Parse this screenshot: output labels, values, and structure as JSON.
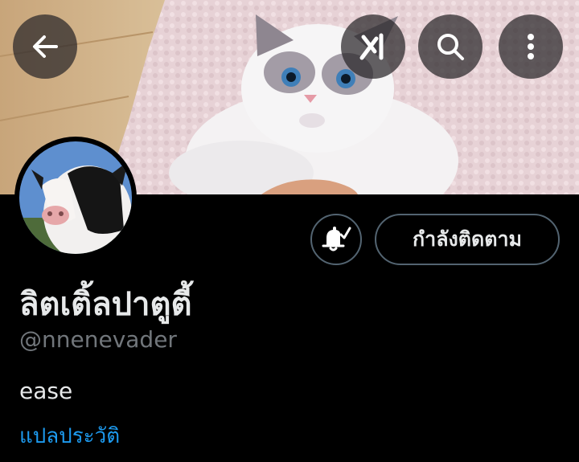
{
  "header": {
    "back_icon": "arrow-left-icon",
    "grok_icon": "grok-icon",
    "search_icon": "search-icon",
    "more_icon": "more-vertical-icon"
  },
  "profile": {
    "display_name": "ลิตเติ้ลปาตูตี้",
    "handle": "@nnenevader",
    "bio": "ease",
    "translate_bio": "แปลประวัติ",
    "follow_state_label": "กำลังติดตาม",
    "notification_icon": "bell-check-icon"
  },
  "colors": {
    "background": "#000000",
    "text_primary": "#e7e9ea",
    "text_secondary": "#71767b",
    "link": "#1d9bf0",
    "button_border": "#536471"
  }
}
